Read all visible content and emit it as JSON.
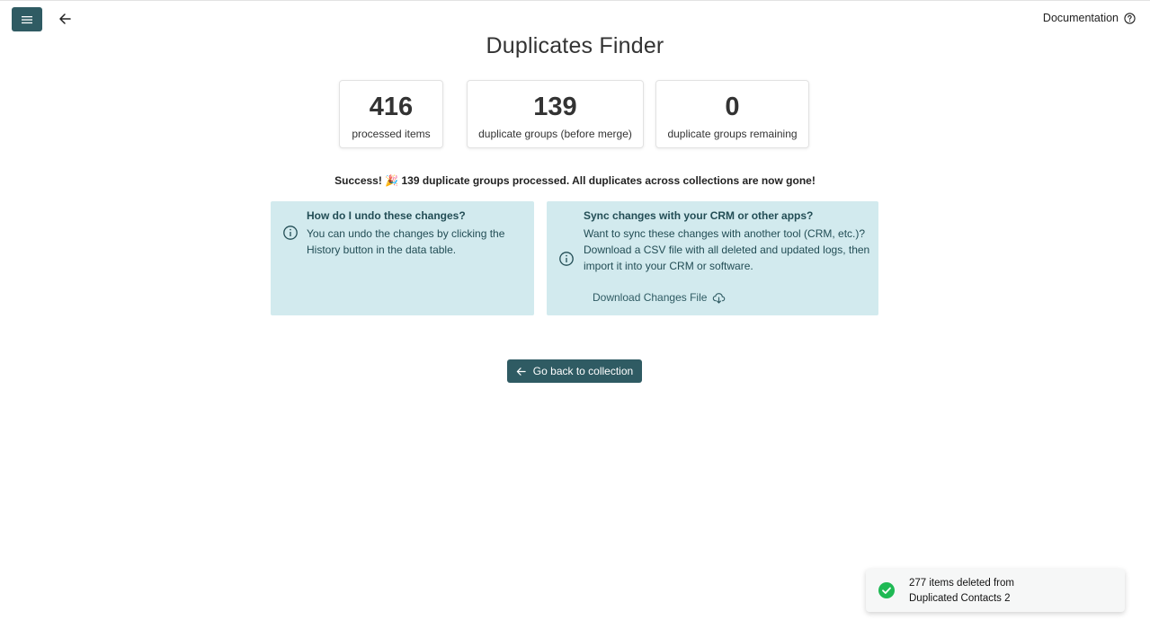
{
  "header": {
    "menu_icon": "hamburger-icon",
    "back_icon": "arrow-left-icon",
    "documentation_label": "Documentation",
    "help_icon": "question-circle-icon"
  },
  "page": {
    "title": "Duplicates Finder"
  },
  "stats": [
    {
      "value": "416",
      "label": "processed items"
    },
    {
      "value": "139",
      "label": "duplicate groups (before merge)"
    },
    {
      "value": "0",
      "label": "duplicate groups remaining"
    }
  ],
  "success_message": "Success! 🎉 139 duplicate groups processed. All duplicates across collections are now gone!",
  "info_undo": {
    "title": "How do I undo these changes?",
    "text": "You can undo the changes by clicking the History button in the data table.",
    "icon": "info-circle-icon"
  },
  "info_sync": {
    "title": "Sync changes with your CRM or other apps?",
    "text": "Want to sync these changes with another tool (CRM, etc.)? Download a CSV file with all deleted and updated logs, then import it into your CRM or software.",
    "download_label": "Download Changes File",
    "icon": "info-circle-icon",
    "download_icon": "cloud-download-icon"
  },
  "go_back_button": {
    "label": "Go back to collection",
    "icon": "arrow-left-icon"
  },
  "toast": {
    "line1": "277 items deleted from",
    "line2": "Duplicated Contacts 2",
    "icon": "check-circle-icon",
    "icon_color": "#1fb954"
  },
  "colors": {
    "primary": "#2f5b63",
    "info_bg": "#d2eaee",
    "info_text": "#224d55"
  }
}
